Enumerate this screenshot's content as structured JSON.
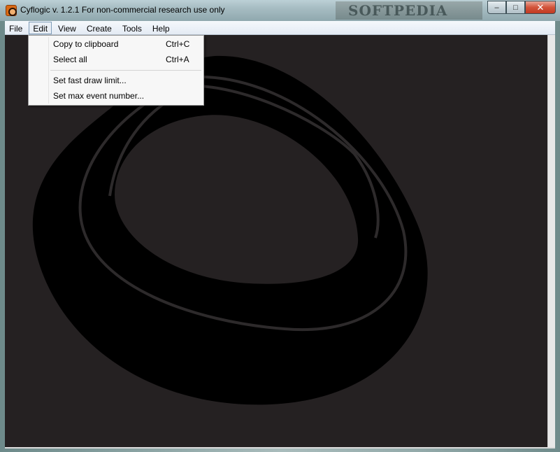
{
  "window": {
    "title": "Cyflogic v. 1.2.1 For non-commercial research use only",
    "watermark": "SOFTPEDIA",
    "controls": {
      "minimize": "–",
      "maximize": "□",
      "close": "✕"
    }
  },
  "menubar": {
    "items": [
      {
        "label": "File"
      },
      {
        "label": "Edit"
      },
      {
        "label": "View"
      },
      {
        "label": "Create"
      },
      {
        "label": "Tools"
      },
      {
        "label": "Help"
      }
    ]
  },
  "edit_menu": {
    "items": [
      {
        "label": "Copy to clipboard",
        "shortcut": "Ctrl+C"
      },
      {
        "label": "Select all",
        "shortcut": "Ctrl+A"
      },
      {
        "label": "Set fast draw limit..."
      },
      {
        "label": "Set max event number..."
      }
    ]
  },
  "colors": {
    "canvas_bg": "#252122",
    "shape_fill": "#000000",
    "shape_line": "#2d2a2b"
  },
  "icons": {
    "app": "cyflogic-app-icon"
  }
}
